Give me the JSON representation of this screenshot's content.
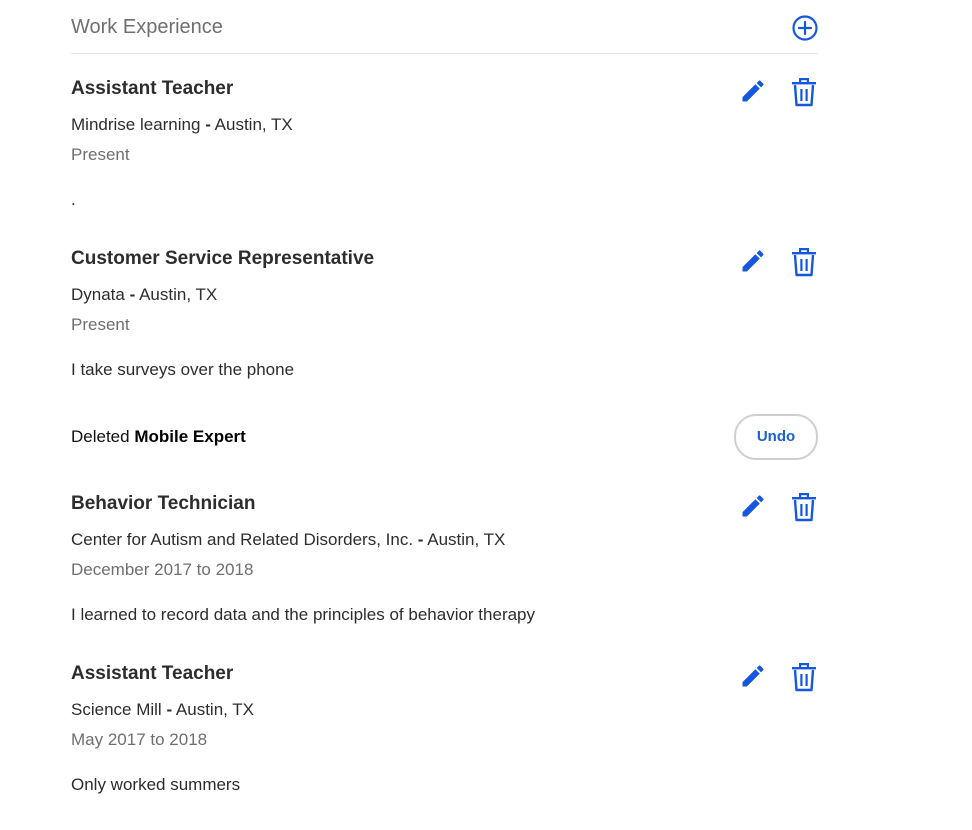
{
  "section": {
    "title": "Work Experience",
    "add_icon": "plus-circle-icon",
    "accent_color": "#1557e0"
  },
  "jobs": [
    {
      "title": "Assistant Teacher",
      "company": "Mindrise learning",
      "separator": "-",
      "location": "Austin, TX",
      "dates": "Present",
      "description": "."
    },
    {
      "title": "Customer Service Representative",
      "company": "Dynata",
      "separator": "-",
      "location": "Austin, TX",
      "dates": "Present",
      "description": "I take surveys over the phone"
    },
    {
      "title": "Behavior Technician",
      "company": "Center for Autism and Related Disorders, Inc.",
      "separator": "-",
      "location": "Austin, TX",
      "dates": "December 2017 to 2018",
      "description": "I learned to record data and the principles of behavior therapy"
    },
    {
      "title": "Assistant Teacher",
      "company": "Science Mill",
      "separator": "-",
      "location": "Austin, TX",
      "dates": "May 2017 to 2018",
      "description": "Only worked summers"
    }
  ],
  "deleted_notice": {
    "prefix": "Deleted",
    "item": "Mobile Expert",
    "undo_label": "Undo"
  },
  "icons": {
    "edit": "pencil-icon",
    "delete": "trash-icon"
  }
}
